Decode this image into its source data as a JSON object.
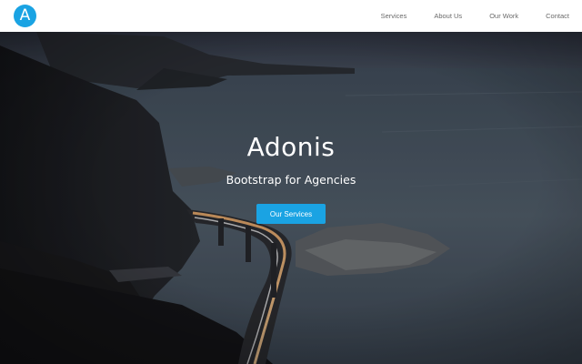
{
  "brand": {
    "logo_letter": "A",
    "logo_icon": "circle-letter-a-logo",
    "accent_color": "#1aa3e3"
  },
  "nav": {
    "items": [
      {
        "label": "Services"
      },
      {
        "label": "About Us"
      },
      {
        "label": "Our Work"
      },
      {
        "label": "Contact"
      }
    ]
  },
  "hero": {
    "title": "Adonis",
    "subtitle": "Bootstrap for Agencies",
    "cta_label": "Our Services",
    "background": "coastal-cliffs-bridge-night-photo"
  }
}
